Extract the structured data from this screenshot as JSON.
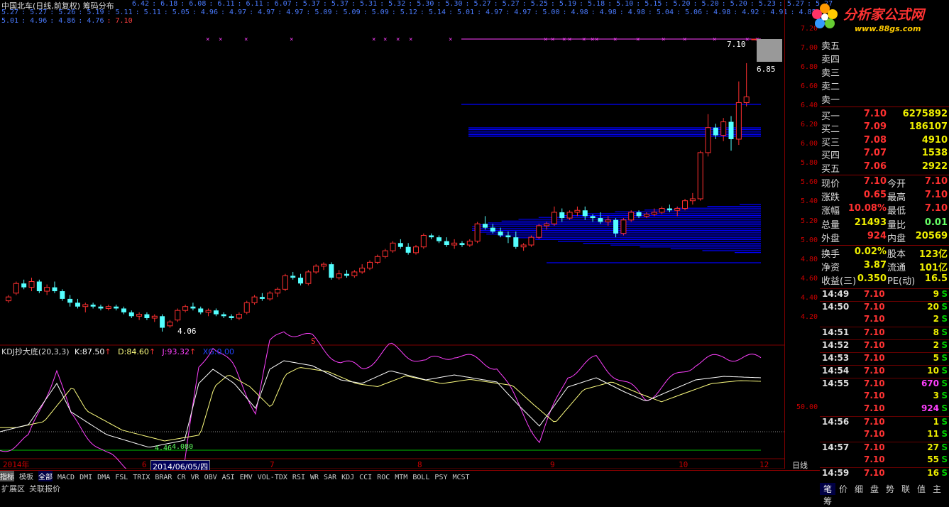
{
  "window": {
    "title": "中国北车(日线,前复权) 筹码分布"
  },
  "top_values": {
    "row1": [
      "6.42",
      "6.18",
      "6.08",
      "6.11",
      "6.11",
      "6.07",
      "5.37",
      "5.37",
      "5.31",
      "5.32",
      "5.30",
      "5.30",
      "5.27",
      "5.27",
      "5.25",
      "5.19",
      "5.18",
      "5.10",
      "5.15",
      "5.20",
      "5.20",
      "5.20",
      "5.23",
      "5.27",
      "5.27"
    ],
    "row2": [
      "5.27",
      "5.27",
      "5.26",
      "5.19",
      "5.11",
      "5.11",
      "5.05",
      "4.96",
      "4.97",
      "4.97",
      "4.97",
      "5.09",
      "5.09",
      "5.09",
      "5.12",
      "5.14",
      "5.01",
      "4.97",
      "4.97",
      "5.00",
      "4.98",
      "4.98",
      "4.98",
      "5.04",
      "5.06",
      "4.98",
      "4.92",
      "4.91",
      "4.85"
    ],
    "row3": [
      "5.01",
      "4.96",
      "4.86",
      "4.76"
    ],
    "row3_last": "7.10"
  },
  "price_axis": [
    "7.20",
    "7.00",
    "6.80",
    "6.60",
    "6.40",
    "6.20",
    "6.00",
    "5.80",
    "5.60",
    "5.40",
    "5.20",
    "5.00",
    "4.80",
    "4.60",
    "4.40",
    "4.20"
  ],
  "annotations": {
    "high_label": "7.10",
    "right_label": "6.85",
    "low_label": "4.06",
    "kdj_low_a": "4.46",
    "kdj_low_b": "4.080",
    "s_marker": "S"
  },
  "kdj": {
    "name": "KDJ抄大底(20,3,3)",
    "k_label": "K:",
    "k": "87.50",
    "d_label": "D:",
    "d": "84.60",
    "j_label": "J:",
    "j": "93.32",
    "xg_label": "XG:",
    "xg": "0.00",
    "level": "50.00"
  },
  "x_axis": [
    "2014年",
    "6",
    "7",
    "8",
    "9",
    "10",
    "12"
  ],
  "cursor_date": "2014/06/05/四",
  "period_label": "日线",
  "indicators": [
    "指标",
    "模板",
    "全部",
    "MACD",
    "DMI",
    "DMA",
    "FSL",
    "TRIX",
    "BRAR",
    "CR",
    "VR",
    "OBV",
    "ASI",
    "EMV",
    "VOL-TDX",
    "RSI",
    "WR",
    "SAR",
    "KDJ",
    "CCI",
    "ROC",
    "MTM",
    "BOLL",
    "PSY",
    "MCST"
  ],
  "bottom_tabs": [
    "扩展区",
    "关联报价"
  ],
  "logo": {
    "text": "分析家公式网",
    "url": "www.88gs.com"
  },
  "orderbook": {
    "asks": [
      {
        "label": "卖五"
      },
      {
        "label": "卖四"
      },
      {
        "label": "卖三"
      },
      {
        "label": "卖二"
      },
      {
        "label": "卖一"
      }
    ],
    "bids": [
      {
        "label": "买一",
        "price": "7.10",
        "vol": "6275892"
      },
      {
        "label": "买二",
        "price": "7.09",
        "vol": "186107"
      },
      {
        "label": "买三",
        "price": "7.08",
        "vol": "4910"
      },
      {
        "label": "买四",
        "price": "7.07",
        "vol": "1538"
      },
      {
        "label": "买五",
        "price": "7.06",
        "vol": "2922"
      }
    ]
  },
  "stats": [
    {
      "l1": "现价",
      "v1": "7.10",
      "l2": "今开",
      "v2": "7.10"
    },
    {
      "l1": "涨跌",
      "v1": "0.65",
      "l2": "最高",
      "v2": "7.10"
    },
    {
      "l1": "涨幅",
      "v1": "10.08%",
      "l2": "最低",
      "v2": "7.10"
    },
    {
      "l1": "总量",
      "v1": "21493",
      "l2": "量比",
      "v2": "0.01"
    },
    {
      "l1": "外盘",
      "v1": "924",
      "l2": "内盘",
      "v2": "20569"
    },
    {
      "l1": "换手",
      "v1": "0.02%",
      "l2": "股本",
      "v2": "123亿"
    },
    {
      "l1": "净资",
      "v1": "3.87",
      "l2": "流通",
      "v2": "101亿"
    },
    {
      "l1": "收益(三)",
      "v1": "0.350",
      "l2": "PE(动)",
      "v2": "16.5"
    }
  ],
  "ticks": [
    {
      "time": "14:49",
      "price": "7.10",
      "vol": "9",
      "side": "S"
    },
    {
      "time": "14:50",
      "price": "7.10",
      "vol": "20",
      "side": "S"
    },
    {
      "time": "",
      "price": "7.10",
      "vol": "2",
      "side": "S"
    },
    {
      "time": "14:51",
      "price": "7.10",
      "vol": "8",
      "side": "S"
    },
    {
      "time": "14:52",
      "price": "7.10",
      "vol": "2",
      "side": "S"
    },
    {
      "time": "14:53",
      "price": "7.10",
      "vol": "5",
      "side": "S"
    },
    {
      "time": "14:54",
      "price": "7.10",
      "vol": "10",
      "side": "S"
    },
    {
      "time": "14:55",
      "price": "7.10",
      "vol": "670",
      "side": "S"
    },
    {
      "time": "",
      "price": "7.10",
      "vol": "3",
      "side": "S"
    },
    {
      "time": "",
      "price": "7.10",
      "vol": "924",
      "side": "S"
    },
    {
      "time": "14:56",
      "price": "7.10",
      "vol": "1",
      "side": "S"
    },
    {
      "time": "",
      "price": "7.10",
      "vol": "11",
      "side": "S"
    },
    {
      "time": "14:57",
      "price": "7.10",
      "vol": "27",
      "side": "S"
    },
    {
      "time": "",
      "price": "7.10",
      "vol": "55",
      "side": "S"
    },
    {
      "time": "14:59",
      "price": "7.10",
      "vol": "16",
      "side": "S"
    }
  ],
  "sidebar_tabs": [
    "笔",
    "价",
    "细",
    "盘",
    "势",
    "联",
    "值",
    "主",
    "筹"
  ],
  "colors": {
    "up": "#ff3030",
    "down": "#54ffff",
    "chip": "#0000ff",
    "k_line": "#ffffff",
    "d_line": "#ffff80",
    "j_line": "#ff40ff"
  },
  "chart_data": {
    "type": "candlestick",
    "period": "daily",
    "candles_ohlc": [
      [
        4.38,
        4.44,
        4.36,
        4.42
      ],
      [
        4.46,
        4.58,
        4.44,
        4.56
      ],
      [
        4.56,
        4.6,
        4.5,
        4.52
      ],
      [
        4.52,
        4.62,
        4.48,
        4.58
      ],
      [
        4.58,
        4.6,
        4.46,
        4.48
      ],
      [
        4.48,
        4.55,
        4.44,
        4.52
      ],
      [
        4.52,
        4.58,
        4.46,
        4.48
      ],
      [
        4.48,
        4.5,
        4.38,
        4.4
      ],
      [
        4.4,
        4.44,
        4.32,
        4.36
      ],
      [
        4.36,
        4.4,
        4.3,
        4.32
      ],
      [
        4.32,
        4.36,
        4.26,
        4.34
      ],
      [
        4.34,
        4.36,
        4.3,
        4.32
      ],
      [
        4.32,
        4.34,
        4.28,
        4.3
      ],
      [
        4.3,
        4.34,
        4.28,
        4.32
      ],
      [
        4.32,
        4.34,
        4.28,
        4.3
      ],
      [
        4.3,
        4.32,
        4.24,
        4.26
      ],
      [
        4.26,
        4.28,
        4.2,
        4.22
      ],
      [
        4.22,
        4.26,
        4.18,
        4.24
      ],
      [
        4.24,
        4.26,
        4.18,
        4.2
      ],
      [
        4.2,
        4.24,
        4.16,
        4.22
      ],
      [
        4.22,
        4.24,
        4.06,
        4.1
      ],
      [
        4.12,
        4.18,
        4.1,
        4.16
      ],
      [
        4.18,
        4.3,
        4.16,
        4.28
      ],
      [
        4.28,
        4.34,
        4.26,
        4.32
      ],
      [
        4.32,
        4.36,
        4.28,
        4.3
      ],
      [
        4.3,
        4.32,
        4.24,
        4.26
      ],
      [
        4.26,
        4.3,
        4.22,
        4.28
      ],
      [
        4.28,
        4.3,
        4.22,
        4.24
      ],
      [
        4.24,
        4.26,
        4.2,
        4.22
      ],
      [
        4.22,
        4.24,
        4.18,
        4.2
      ],
      [
        4.2,
        4.26,
        4.18,
        4.24
      ],
      [
        4.26,
        4.38,
        4.24,
        4.36
      ],
      [
        4.36,
        4.44,
        4.34,
        4.42
      ],
      [
        4.42,
        4.46,
        4.38,
        4.4
      ],
      [
        4.4,
        4.48,
        4.38,
        4.46
      ],
      [
        4.46,
        4.52,
        4.42,
        4.5
      ],
      [
        4.5,
        4.66,
        4.48,
        4.64
      ],
      [
        4.64,
        4.68,
        4.6,
        4.62
      ],
      [
        4.62,
        4.66,
        4.54,
        4.56
      ],
      [
        4.56,
        4.7,
        4.54,
        4.68
      ],
      [
        4.68,
        4.76,
        4.66,
        4.74
      ],
      [
        4.74,
        4.78,
        4.7,
        4.76
      ],
      [
        4.76,
        4.78,
        4.6,
        4.62
      ],
      [
        4.62,
        4.7,
        4.6,
        4.66
      ],
      [
        4.66,
        4.7,
        4.62,
        4.64
      ],
      [
        4.64,
        4.7,
        4.62,
        4.68
      ],
      [
        4.68,
        4.76,
        4.66,
        4.72
      ],
      [
        4.72,
        4.8,
        4.7,
        4.78
      ],
      [
        4.78,
        4.86,
        4.76,
        4.84
      ],
      [
        4.84,
        4.92,
        4.82,
        4.9
      ],
      [
        4.9,
        5.0,
        4.88,
        4.98
      ],
      [
        4.98,
        5.02,
        4.92,
        4.94
      ],
      [
        4.94,
        4.98,
        4.86,
        4.88
      ],
      [
        4.88,
        4.96,
        4.86,
        4.94
      ],
      [
        4.94,
        5.08,
        4.92,
        5.06
      ],
      [
        5.06,
        5.08,
        5.02,
        5.04
      ],
      [
        5.04,
        5.06,
        4.98,
        5.0
      ],
      [
        5.0,
        5.04,
        4.94,
        4.96
      ],
      [
        4.96,
        5.02,
        4.92,
        4.98
      ],
      [
        4.98,
        5.0,
        4.94,
        4.96
      ],
      [
        4.96,
        5.02,
        4.94,
        5.0
      ],
      [
        5.0,
        5.2,
        4.98,
        5.18
      ],
      [
        5.18,
        5.26,
        5.12,
        5.14
      ],
      [
        5.14,
        5.18,
        5.08,
        5.1
      ],
      [
        5.1,
        5.14,
        5.04,
        5.06
      ],
      [
        5.06,
        5.1,
        4.98,
        5.04
      ],
      [
        5.04,
        5.1,
        4.92,
        4.94
      ],
      [
        4.94,
        4.98,
        4.9,
        4.96
      ],
      [
        4.96,
        5.06,
        4.94,
        5.04
      ],
      [
        5.04,
        5.18,
        5.02,
        5.16
      ],
      [
        5.16,
        5.2,
        5.12,
        5.18
      ],
      [
        5.18,
        5.36,
        5.16,
        5.3
      ],
      [
        5.3,
        5.34,
        5.2,
        5.24
      ],
      [
        5.24,
        5.32,
        5.22,
        5.3
      ],
      [
        5.3,
        5.36,
        5.26,
        5.32
      ],
      [
        5.32,
        5.36,
        5.22,
        5.26
      ],
      [
        5.26,
        5.28,
        5.2,
        5.24
      ],
      [
        5.24,
        5.3,
        5.18,
        5.2
      ],
      [
        5.2,
        5.26,
        5.16,
        5.22
      ],
      [
        5.22,
        5.24,
        5.04,
        5.08
      ],
      [
        5.08,
        5.24,
        5.06,
        5.22
      ],
      [
        5.22,
        5.32,
        5.2,
        5.3
      ],
      [
        5.3,
        5.32,
        5.24,
        5.26
      ],
      [
        5.26,
        5.3,
        5.24,
        5.28
      ],
      [
        5.28,
        5.34,
        5.26,
        5.3
      ],
      [
        5.3,
        5.36,
        5.28,
        5.34
      ],
      [
        5.34,
        5.38,
        5.3,
        5.32
      ],
      [
        5.32,
        5.36,
        5.26,
        5.34
      ],
      [
        5.34,
        5.44,
        5.32,
        5.42
      ],
      [
        5.42,
        5.5,
        5.38,
        5.44
      ],
      [
        5.44,
        5.94,
        5.42,
        5.92
      ],
      [
        5.92,
        6.32,
        5.88,
        6.18
      ],
      [
        6.18,
        6.22,
        6.06,
        6.1
      ],
      [
        6.1,
        6.28,
        6.04,
        6.24
      ],
      [
        6.24,
        6.3,
        5.94,
        6.06
      ],
      [
        6.06,
        6.66,
        6.0,
        6.44
      ],
      [
        6.44,
        6.85,
        6.4,
        6.5
      ],
      [
        7.1,
        7.1,
        7.1,
        7.1
      ]
    ]
  }
}
